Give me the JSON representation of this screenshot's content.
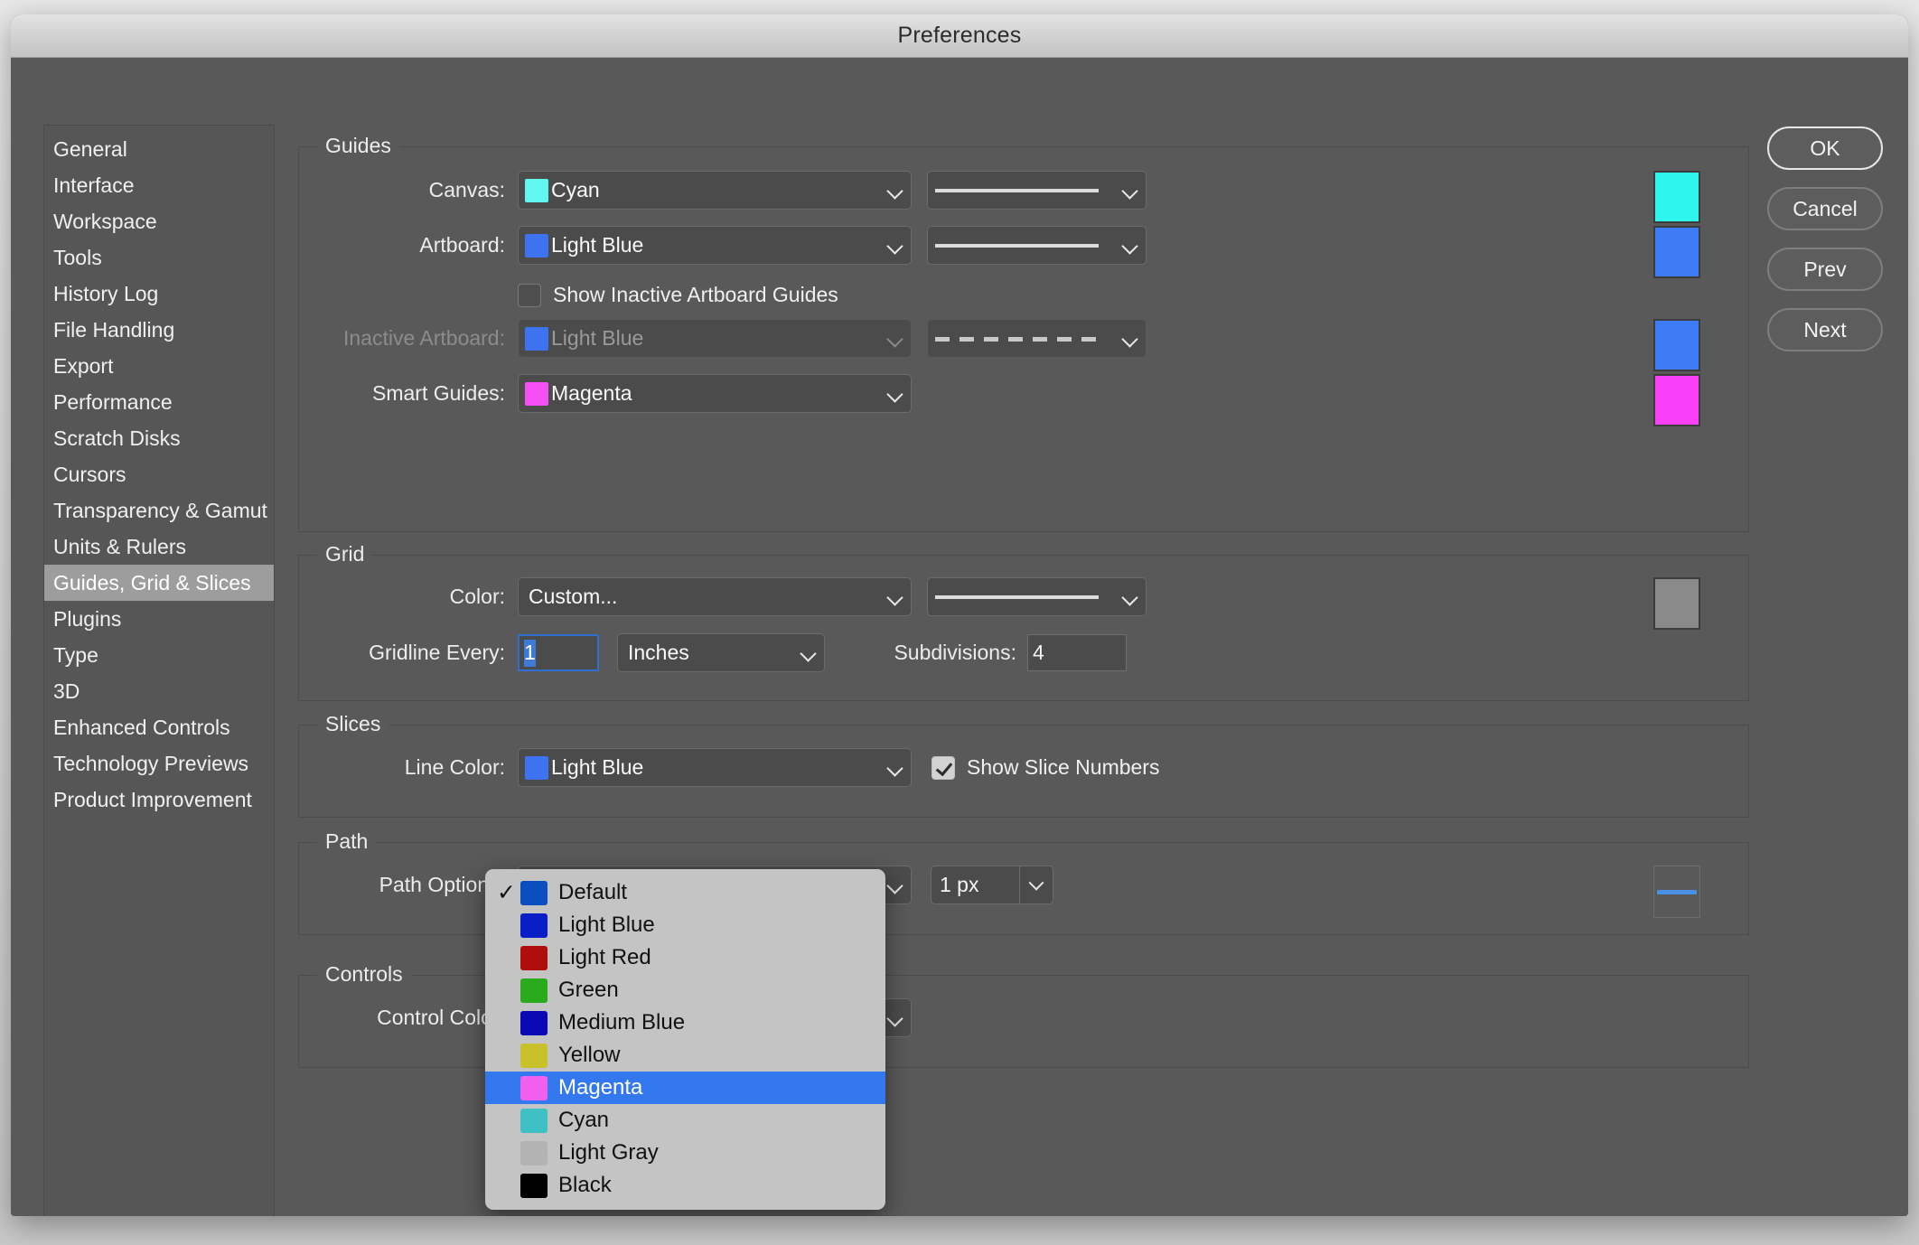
{
  "window": {
    "title": "Preferences"
  },
  "sidebar": {
    "items": [
      {
        "label": "General",
        "selected": false
      },
      {
        "label": "Interface",
        "selected": false
      },
      {
        "label": "Workspace",
        "selected": false
      },
      {
        "label": "Tools",
        "selected": false
      },
      {
        "label": "History Log",
        "selected": false
      },
      {
        "label": "File Handling",
        "selected": false
      },
      {
        "label": "Export",
        "selected": false
      },
      {
        "label": "Performance",
        "selected": false
      },
      {
        "label": "Scratch Disks",
        "selected": false
      },
      {
        "label": "Cursors",
        "selected": false
      },
      {
        "label": "Transparency & Gamut",
        "selected": false
      },
      {
        "label": "Units & Rulers",
        "selected": false
      },
      {
        "label": "Guides, Grid & Slices",
        "selected": true
      },
      {
        "label": "Plugins",
        "selected": false
      },
      {
        "label": "Type",
        "selected": false
      },
      {
        "label": "3D",
        "selected": false
      },
      {
        "label": "Enhanced Controls",
        "selected": false
      },
      {
        "label": "Technology Previews",
        "selected": false
      },
      {
        "label": "Product Improvement",
        "selected": false
      }
    ]
  },
  "buttons": {
    "ok": "OK",
    "cancel": "Cancel",
    "prev": "Prev",
    "next": "Next"
  },
  "guides": {
    "legend": "Guides",
    "canvas": {
      "label": "Canvas:",
      "value": "Cyan",
      "swatch": "#5ff7f0",
      "line_style": "solid",
      "preview_color": "#2ef6ee"
    },
    "artboard": {
      "label": "Artboard:",
      "value": "Light Blue",
      "swatch": "#3d73f0",
      "line_style": "solid",
      "preview_color": "#3d7cf5"
    },
    "show_inactive": {
      "label": "Show Inactive Artboard Guides",
      "checked": false
    },
    "inactive_artboard": {
      "label": "Inactive Artboard:",
      "value": "Light Blue",
      "swatch": "#3d73f0",
      "line_style": "dashed",
      "preview_color": "#3d7cf5",
      "disabled": true
    },
    "smart_guides": {
      "label": "Smart Guides:",
      "value": "Magenta",
      "swatch": "#f44ff4",
      "preview_color": "#fa3ff8"
    }
  },
  "grid": {
    "legend": "Grid",
    "color": {
      "label": "Color:",
      "value": "Custom...",
      "line_style": "solid",
      "preview_color": "#8a8a8a"
    },
    "gridline_every": {
      "label": "Gridline Every:",
      "value": "1",
      "selected": true
    },
    "units": {
      "value": "Inches"
    },
    "subdivisions": {
      "label": "Subdivisions:",
      "value": "4"
    }
  },
  "slices": {
    "legend": "Slices",
    "line_color": {
      "label": "Line Color:",
      "value": "Light Blue",
      "swatch": "#3d73f0"
    },
    "show_slice_numbers": {
      "label": "Show Slice Numbers",
      "checked": true
    }
  },
  "path": {
    "legend": "Path",
    "options": {
      "label": "Path Options:",
      "value": "Default"
    },
    "thickness": {
      "value": "1 px"
    },
    "preview_color": "#4a90e2"
  },
  "controls": {
    "legend": "Controls",
    "control_color": {
      "label": "Control Color:",
      "value": ""
    }
  },
  "dropdown_menu": {
    "options": [
      {
        "label": "Default",
        "swatch": "#0a4ec0",
        "checked": true,
        "highlighted": false
      },
      {
        "label": "Light Blue",
        "swatch": "#0a1ec6",
        "checked": false,
        "highlighted": false
      },
      {
        "label": "Light Red",
        "swatch": "#b00d0d",
        "checked": false,
        "highlighted": false
      },
      {
        "label": "Green",
        "swatch": "#2aab1e",
        "checked": false,
        "highlighted": false
      },
      {
        "label": "Medium Blue",
        "swatch": "#0a09b4",
        "checked": false,
        "highlighted": false
      },
      {
        "label": "Yellow",
        "swatch": "#c9c12a",
        "checked": false,
        "highlighted": false
      },
      {
        "label": "Magenta",
        "swatch": "#f060ec",
        "checked": false,
        "highlighted": true
      },
      {
        "label": "Cyan",
        "swatch": "#3fc0c4",
        "checked": false,
        "highlighted": false
      },
      {
        "label": "Light Gray",
        "swatch": "#b3b3b3",
        "checked": false,
        "highlighted": false
      },
      {
        "label": "Black",
        "swatch": "#000000",
        "checked": false,
        "highlighted": false
      }
    ],
    "check_glyph": "✓"
  }
}
